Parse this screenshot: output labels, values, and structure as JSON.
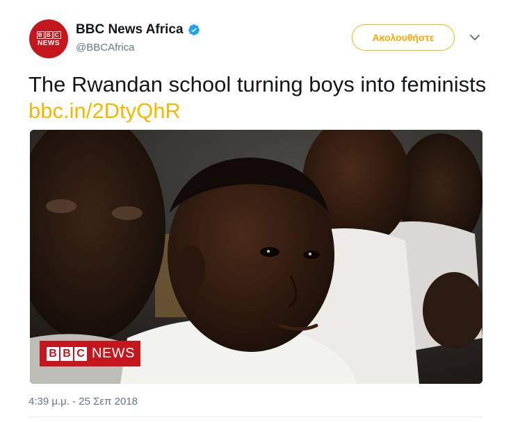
{
  "author": {
    "avatar_text": [
      "B",
      "B",
      "C",
      "NEWS"
    ],
    "display_name": "BBC News Africa",
    "handle": "@BBCAfrica",
    "verified": true
  },
  "actions": {
    "follow_label": "Ακολουθήστε",
    "caret_icon": "chevron-down-icon"
  },
  "tweet": {
    "text": "The Rwandan school turning boys into feminists",
    "link": "bbc.in/2DtyQhR",
    "timestamp": "4:39 μ.μ. - 25 Σεπ 2018"
  },
  "media": {
    "badge_letters": [
      "B",
      "B",
      "C"
    ],
    "badge_word": "NEWS"
  },
  "colors": {
    "link": "#f5b800",
    "bbc_red": "#c4161c",
    "verified_blue": "#1da1f2"
  }
}
